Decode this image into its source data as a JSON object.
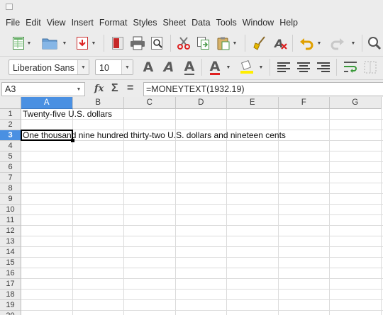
{
  "menubar": {
    "items": [
      "File",
      "Edit",
      "View",
      "Insert",
      "Format",
      "Styles",
      "Sheet",
      "Data",
      "Tools",
      "Window",
      "Help"
    ]
  },
  "toolbar_standard": {
    "icons": [
      "new-spreadsheet-icon",
      "open-folder-icon",
      "save-icon",
      "export-pdf-icon",
      "print-icon",
      "print-preview-icon",
      "cut-icon",
      "copy-icon",
      "paste-icon",
      "clone-formatting-icon",
      "clear-formatting-icon",
      "undo-icon",
      "redo-icon",
      "find-replace-icon"
    ]
  },
  "toolbar_formatting": {
    "font_name": "Liberation Sans",
    "font_size": "10",
    "icons": [
      "bold-icon",
      "italic-icon",
      "underline-icon",
      "font-color-icon",
      "highlight-color-icon",
      "align-left-icon",
      "align-center-icon",
      "align-right-icon",
      "wrap-text-icon",
      "merge-cells-icon"
    ],
    "glyphs": {
      "bold": "A",
      "italic": "A",
      "underline": "A",
      "font_color": "A"
    },
    "colors": {
      "font_color": "#e02020",
      "highlight": "#ffee00",
      "accent": "#4a90e2"
    }
  },
  "formula_bar": {
    "cell_reference": "A3",
    "function_wizard": "fx",
    "sum_symbol": "Σ",
    "equals_symbol": "=",
    "formula": "=MONEYTEXT(1932.19)"
  },
  "sheet": {
    "columns": [
      "A",
      "B",
      "C",
      "D",
      "E",
      "F",
      "G"
    ],
    "active_column": "A",
    "rows": [
      "1",
      "2",
      "3",
      "4",
      "5",
      "6",
      "7",
      "8",
      "9",
      "10",
      "11",
      "12",
      "13",
      "14",
      "15",
      "16",
      "17",
      "18",
      "19",
      "20"
    ],
    "active_row": "3",
    "cells": {
      "A1": "Twenty-five U.S. dollars",
      "A3": "One thousand nine hundred thirty-two U.S. dollars and nineteen cents"
    },
    "selected_cell": "A3"
  }
}
